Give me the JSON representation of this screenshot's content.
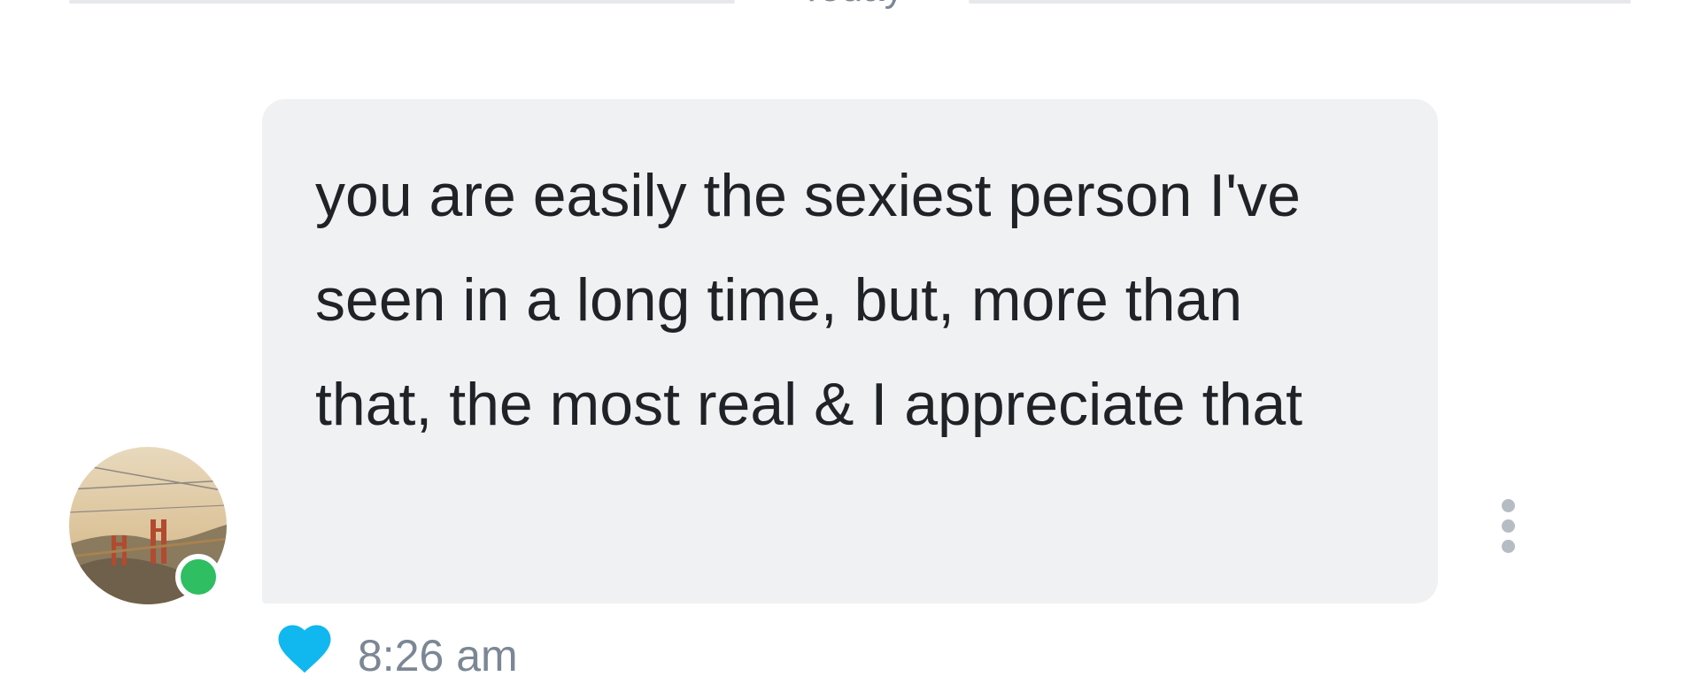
{
  "date_separator": {
    "label": "Today"
  },
  "message": {
    "text": "you are easily the sexiest person I've seen in a long time, but, more than that, the most real & I appreciate that",
    "time": "8:26 am",
    "liked": true
  },
  "sender": {
    "online": true
  },
  "icons": {
    "like": "heart-icon",
    "more": "more-vertical-icon"
  },
  "colors": {
    "bubble": "#f0f1f3",
    "online": "#2fbe62",
    "heart": "#11b7ef",
    "muted_text": "#7b8794"
  }
}
